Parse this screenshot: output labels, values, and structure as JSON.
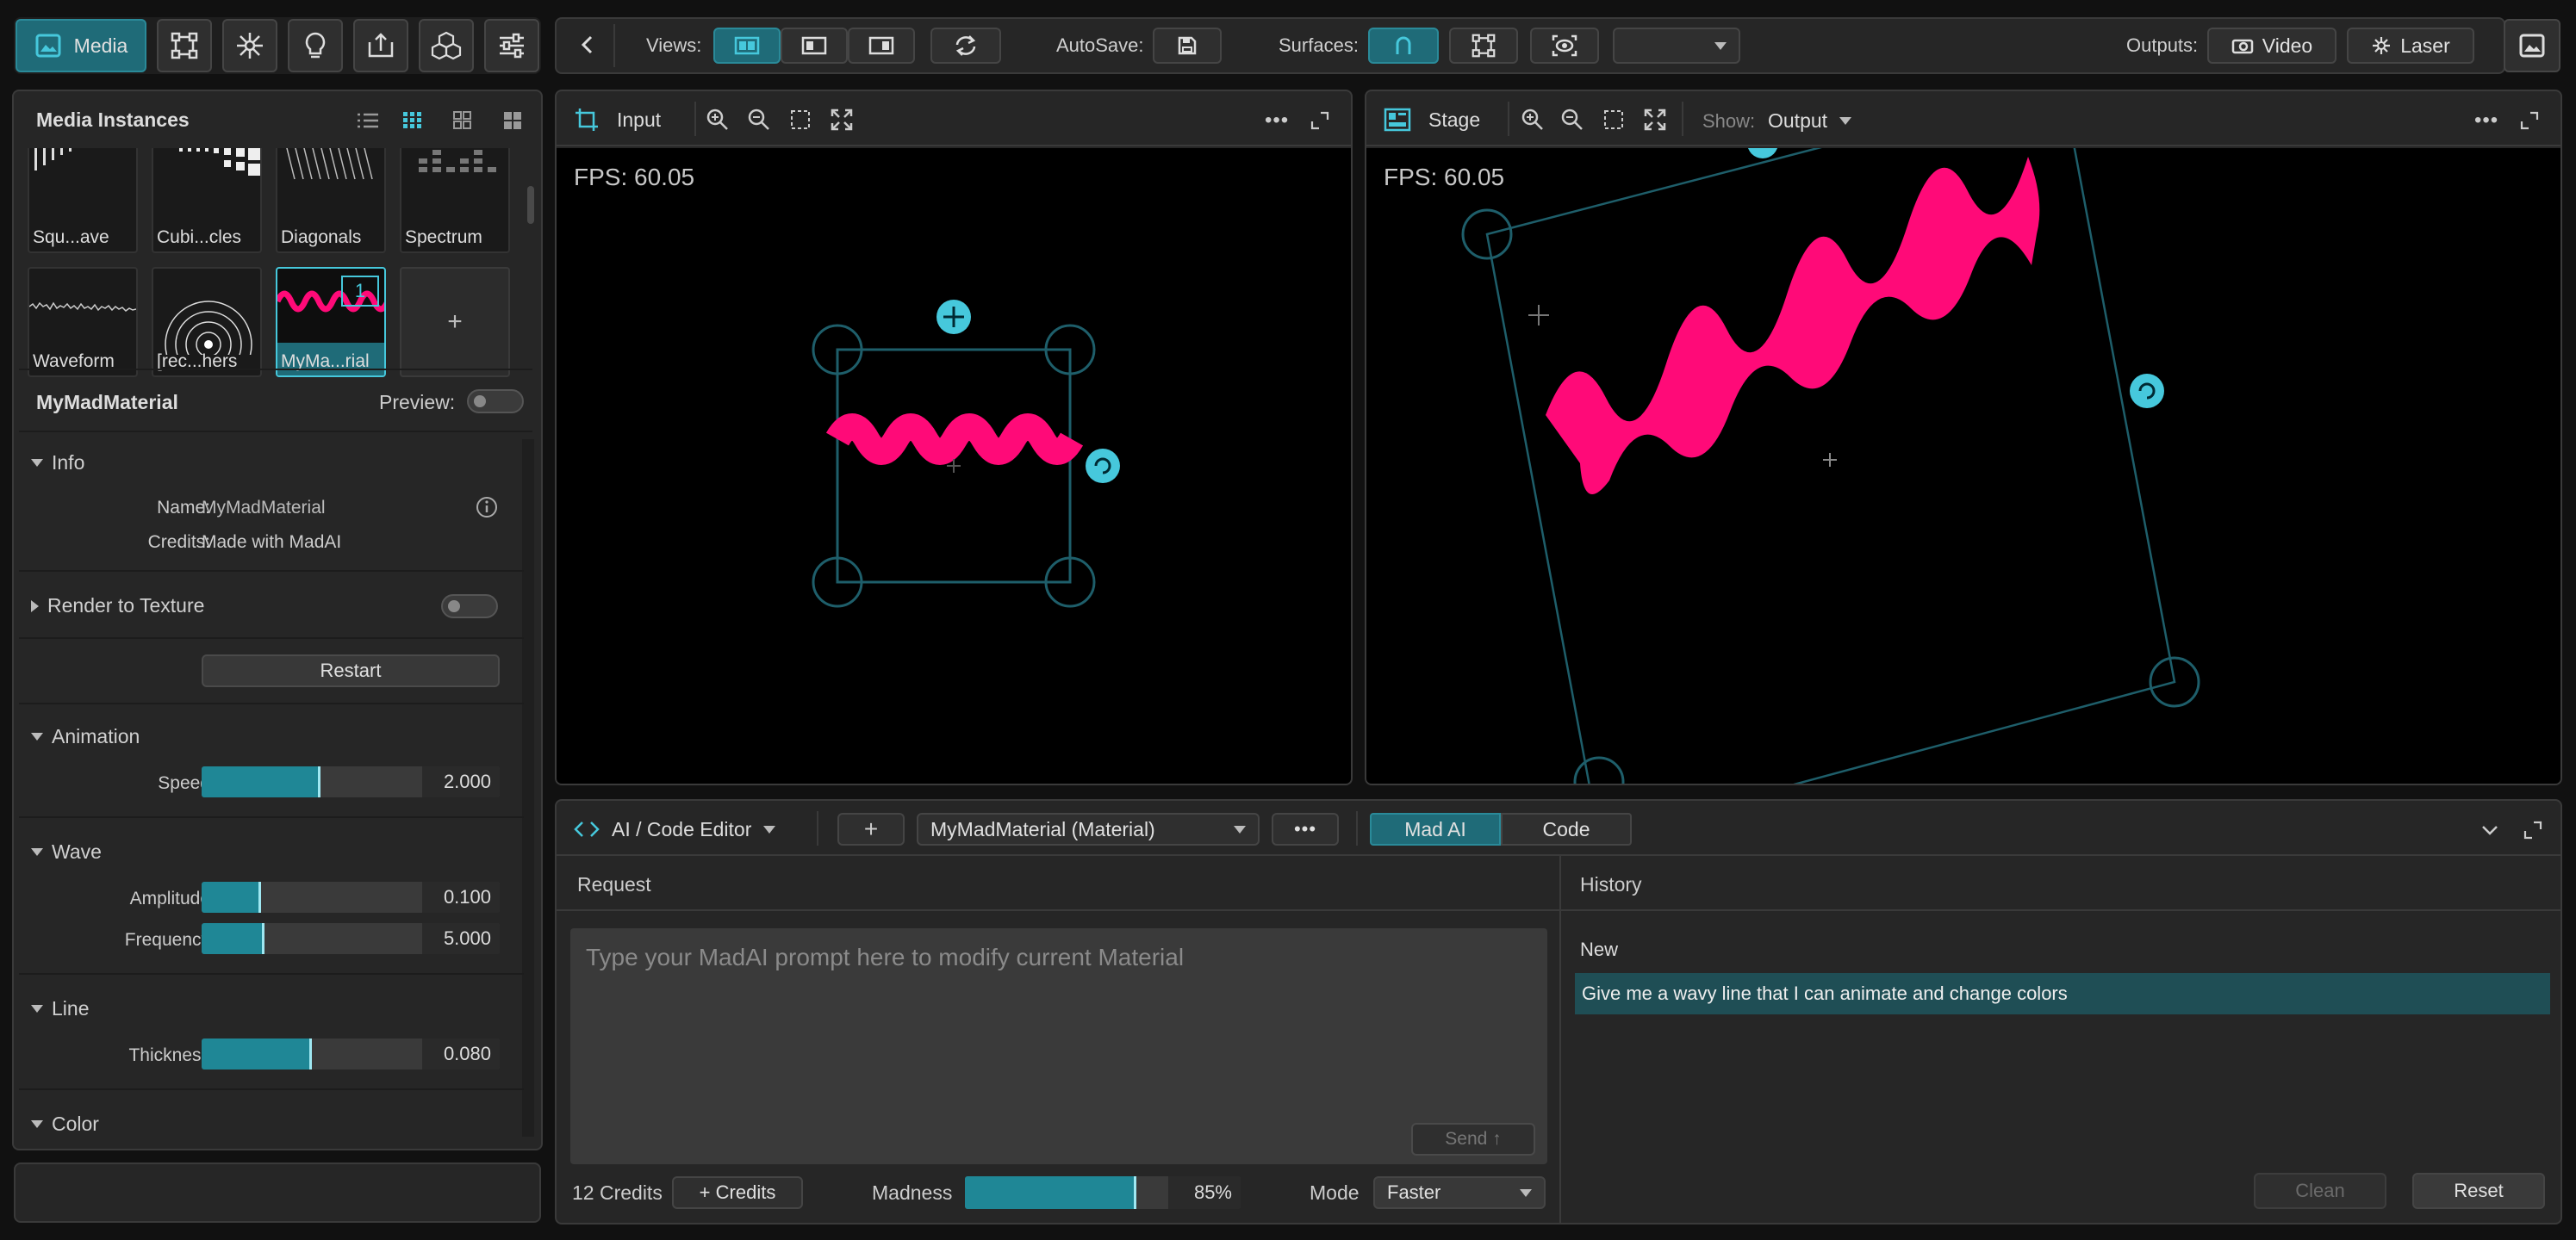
{
  "toolbar": {
    "media_label": "Media",
    "views_label": "Views:",
    "autosave_label": "AutoSave:",
    "surfaces_label": "Surfaces:",
    "outputs_label": "Outputs:",
    "video_label": "Video",
    "laser_label": "Laser"
  },
  "media_panel": {
    "title": "Media Instances",
    "thumbs": [
      {
        "label": "Squ...ave"
      },
      {
        "label": "Cubi...cles"
      },
      {
        "label": "Diagonals"
      },
      {
        "label": "Spectrum"
      },
      {
        "label": "Waveform"
      },
      {
        "label": "[rec...hers"
      },
      {
        "label": "MyMa...rial",
        "badge": "1"
      }
    ],
    "add_symbol": "+"
  },
  "material_panel": {
    "title": "MyMadMaterial",
    "preview_label": "Preview:",
    "info_section": "Info",
    "name_label": "Name:",
    "name_value": "MyMadMaterial",
    "credits_label": "Credits:",
    "credits_value": "Made with MadAI",
    "render_section": "Render to Texture",
    "restart_label": "Restart",
    "animation_section": "Animation",
    "speed_label": "Speed",
    "speed_value": "2.000",
    "speed_fraction": 0.4,
    "wave_section": "Wave",
    "amplitude_label": "Amplitude",
    "amplitude_value": "0.100",
    "amplitude_fraction": 0.2,
    "frequency_label": "Frequency",
    "frequency_value": "5.000",
    "frequency_fraction": 0.21,
    "line_section": "Line",
    "thickness_label": "Thickness",
    "thickness_value": "0.080",
    "thickness_fraction": 0.37,
    "color_section": "Color"
  },
  "input_view": {
    "tab_label": "Input",
    "fps": "FPS: 60.05"
  },
  "stage_view": {
    "tab_label": "Stage",
    "show_label": "Show:",
    "show_value": "Output",
    "fps": "FPS: 60.05"
  },
  "editor": {
    "title": "AI / Code Editor",
    "add_symbol": "+",
    "material_select": "MyMadMaterial (Material)",
    "tab_madai": "Mad AI",
    "tab_code": "Code",
    "request_header": "Request",
    "prompt_placeholder": "Type your MadAI prompt here to modify current Material",
    "send_label": "Send ↑",
    "credits_count": "12 Credits",
    "add_credits": "+ Credits",
    "madness_label": "Madness",
    "madness_value": "85%",
    "madness_fraction": 0.85,
    "mode_label": "Mode",
    "mode_value": "Faster",
    "history_header": "History",
    "history_new": "New",
    "history_item": "Give me a wavy line that I can animate and change colors",
    "clean_label": "Clean",
    "reset_label": "Reset"
  },
  "colors": {
    "accent": "#1f8796",
    "wave": "#ff0a78",
    "gizmo": "#46c8dc"
  }
}
